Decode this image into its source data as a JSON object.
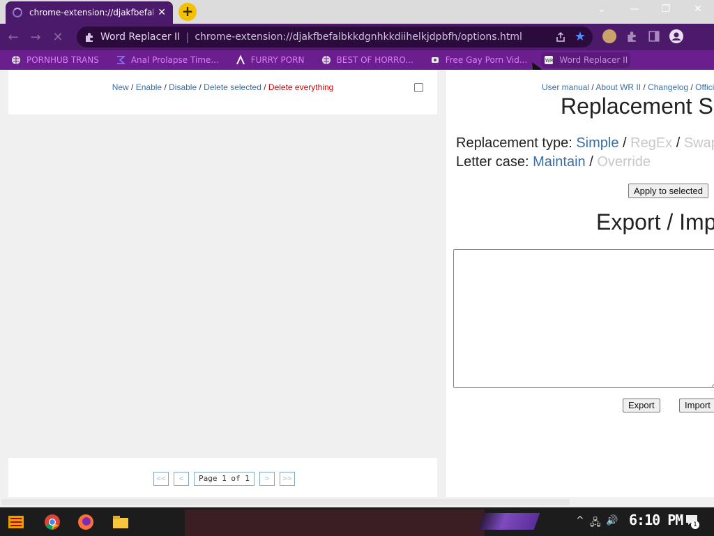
{
  "browser": {
    "tab": {
      "title": "chrome-extension://djakfbefalbkkdgnhkkdiihelkjdpbfh/options.html",
      "close_glyph": "✕"
    },
    "new_tab_glyph": "+",
    "window_controls": {
      "dropdown": "⌄",
      "minimize": "—",
      "restore": "❐",
      "close": "✕"
    },
    "nav": {
      "back": "←",
      "forward": "→",
      "reload": "✕"
    },
    "omnibox": {
      "site_title": "Word Replacer II",
      "url": "chrome-extension://djakfbefalbkkdgnhkkdiihelkjdpbfh/options.html",
      "share_icon": "share-icon",
      "star_glyph": "★"
    },
    "toolbar_icons": [
      "profile-avatar-icon",
      "extensions-puzzle-icon",
      "side-panel-icon",
      "account-icon"
    ]
  },
  "bookmarks": [
    {
      "label": "PORNHUB TRANS",
      "icon": "globe-icon"
    },
    {
      "label": "Anal Prolapse Time...",
      "icon": "sigma-icon"
    },
    {
      "label": "FURRY PORN",
      "icon": "lambda-icon"
    },
    {
      "label": "BEST OF HORRO...",
      "icon": "globe-icon"
    },
    {
      "label": "Free Gay Porn Vid...",
      "icon": "site-icon"
    },
    {
      "label": "Word Replacer II",
      "icon": "wr-icon"
    }
  ],
  "left_panel": {
    "actions": {
      "new": "New",
      "enable": "Enable",
      "disable": "Disable",
      "delete_selected": "Delete selected",
      "delete_everything": "Delete everything",
      "separator": " / "
    },
    "pager": {
      "first": "<<",
      "prev": "<",
      "label": "Page 1 of 1",
      "next": ">",
      "last": ">>"
    }
  },
  "right_panel": {
    "links": {
      "user_manual": "User manual",
      "about": "About WR II",
      "changelog": "Changelog",
      "official": "Official",
      "separator": " / "
    },
    "settings_heading": "Replacement Settings",
    "replacement_type": {
      "label": "Replacement type: ",
      "simple": "Simple",
      "regex": "RegEx",
      "swap": "Swap",
      "separator": " / "
    },
    "letter_case": {
      "label": "Letter case: ",
      "maintain": "Maintain",
      "override": "Override",
      "separator": " / "
    },
    "apply_button": "Apply to selected",
    "export_heading": "Export / Import",
    "export_button": "Export",
    "import_button": "Import"
  },
  "taskbar": {
    "clock": "6:10 PM",
    "notification_count": "1",
    "tray": {
      "chevron": "^",
      "network": "🖧",
      "volume": "🔊"
    }
  }
}
